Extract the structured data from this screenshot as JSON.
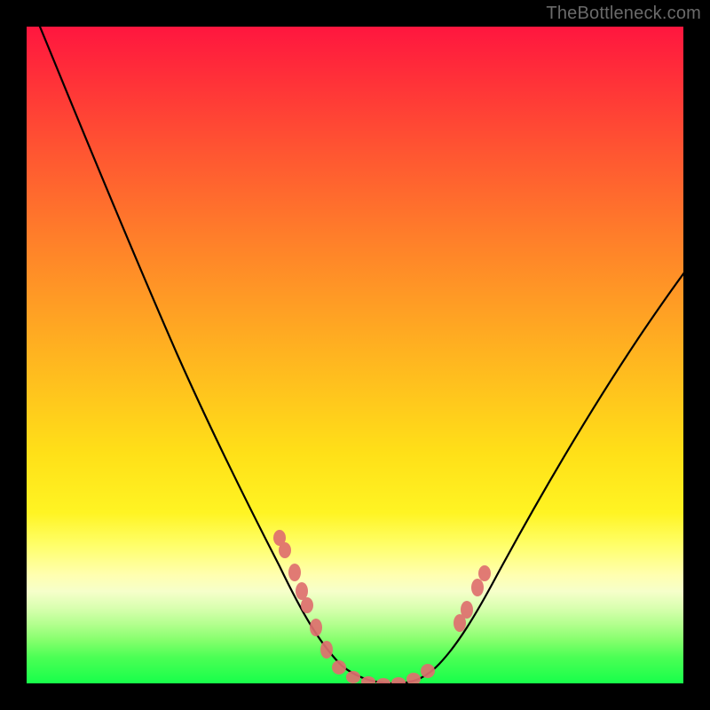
{
  "watermark": {
    "text": "TheBottleneck.com"
  },
  "chart_data": {
    "type": "line",
    "title": "",
    "xlabel": "",
    "ylabel": "",
    "xlim": [
      0,
      100
    ],
    "ylim": [
      0,
      100
    ],
    "background_gradient": {
      "direction": "vertical",
      "stops": [
        {
          "pos": 0,
          "color": "#ff163f"
        },
        {
          "pos": 32,
          "color": "#ff7e2a"
        },
        {
          "pos": 65,
          "color": "#ffe018"
        },
        {
          "pos": 85,
          "color": "#ffffb0"
        },
        {
          "pos": 100,
          "color": "#17ff4a"
        }
      ]
    },
    "series": [
      {
        "name": "bottleneck-curve",
        "color": "#000000",
        "x": [
          0,
          5,
          10,
          15,
          20,
          25,
          30,
          35,
          38,
          40,
          43,
          46,
          49,
          52,
          55,
          58,
          61,
          64,
          67,
          70,
          74,
          78,
          82,
          86,
          90,
          94,
          98,
          100
        ],
        "y": [
          100,
          93,
          85,
          77,
          69,
          60,
          51,
          40,
          32,
          26,
          18,
          11,
          5,
          1,
          0,
          0,
          1,
          4,
          8,
          13,
          20,
          27,
          34,
          41,
          48,
          55,
          62,
          65
        ]
      }
    ],
    "markers": {
      "name": "highlight-dots",
      "color": "#e06a6a",
      "radius_px": 7,
      "points": [
        {
          "x": 38,
          "y": 24
        },
        {
          "x": 39,
          "y": 21
        },
        {
          "x": 41,
          "y": 16
        },
        {
          "x": 42,
          "y": 13
        },
        {
          "x": 43,
          "y": 10
        },
        {
          "x": 45,
          "y": 6
        },
        {
          "x": 47,
          "y": 3
        },
        {
          "x": 49,
          "y": 1
        },
        {
          "x": 51,
          "y": 0
        },
        {
          "x": 53,
          "y": 0
        },
        {
          "x": 55,
          "y": 0
        },
        {
          "x": 57,
          "y": 0
        },
        {
          "x": 59,
          "y": 1
        },
        {
          "x": 61,
          "y": 3
        },
        {
          "x": 66,
          "y": 11
        },
        {
          "x": 67,
          "y": 13
        },
        {
          "x": 69,
          "y": 17
        },
        {
          "x": 70,
          "y": 19
        }
      ]
    }
  }
}
